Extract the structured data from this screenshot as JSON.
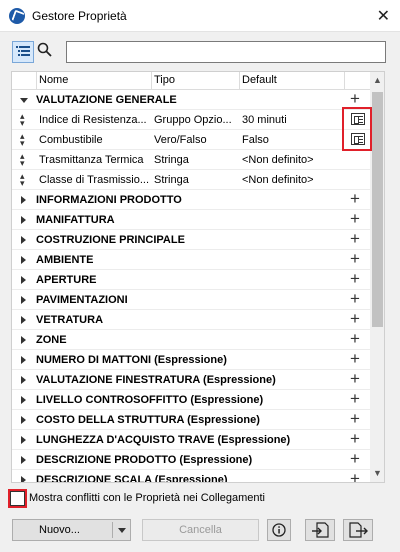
{
  "window": {
    "title": "Gestore Proprietà",
    "close_glyph": "✕",
    "app_icon": "archicad-logo-icon"
  },
  "toolbar": {
    "list_view_icon": "list-view-icon",
    "search_icon": "search-icon",
    "search_value": ""
  },
  "table": {
    "columns": [
      "Nome",
      "Tipo",
      "Default"
    ],
    "groups": [
      {
        "label": "VALUTAZIONE GENERALE",
        "expanded": true,
        "properties": [
          {
            "name": "Indice di Resistenza...",
            "type": "Gruppo Opzio...",
            "default": "30 minuti",
            "icon": "expression-doc-icon"
          },
          {
            "name": "Combustibile",
            "type": "Vero/Falso",
            "default": "Falso",
            "icon": "expression-doc-icon"
          },
          {
            "name": "Trasmittanza Termica",
            "type": "Stringa",
            "default": "<Non definito>",
            "icon": ""
          },
          {
            "name": "Classe di Trasmissio...",
            "type": "Stringa",
            "default": "<Non definito>",
            "icon": ""
          }
        ]
      },
      {
        "label": "INFORMAZIONI PRODOTTO",
        "expanded": false
      },
      {
        "label": "MANIFATTURA",
        "expanded": false
      },
      {
        "label": "COSTRUZIONE PRINCIPALE",
        "expanded": false
      },
      {
        "label": "AMBIENTE",
        "expanded": false
      },
      {
        "label": "APERTURE",
        "expanded": false
      },
      {
        "label": "PAVIMENTAZIONI",
        "expanded": false
      },
      {
        "label": "VETRATURA",
        "expanded": false
      },
      {
        "label": "ZONE",
        "expanded": false
      },
      {
        "label": "NUMERO DI MATTONI (Espressione)",
        "expanded": false
      },
      {
        "label": "VALUTAZIONE FINESTRATURA (Espressione)",
        "expanded": false
      },
      {
        "label": "LIVELLO CONTROSOFFITTO (Espressione)",
        "expanded": false
      },
      {
        "label": "COSTO DELLA STRUTTURA (Espressione)",
        "expanded": false
      },
      {
        "label": "LUNGHEZZA D'ACQUISTO TRAVE (Espressione)",
        "expanded": false
      },
      {
        "label": "DESCRIZIONE PRODOTTO (Espressione)",
        "expanded": false
      },
      {
        "label": "DESCRIZIONE SCALA (Espressione)",
        "expanded": false
      }
    ]
  },
  "options": {
    "show_conflicts_label": "Mostra conflitti con le Proprietà nei Collegamenti",
    "show_conflicts_checked": false
  },
  "buttons": {
    "new_label": "Nuovo...",
    "cancel_label": "Cancella",
    "info_icon": "info-icon",
    "import_icon": "import-icon",
    "export_icon": "export-icon"
  },
  "colors": {
    "highlight": "#e0202a",
    "selected_tool": "#d6e8fb"
  }
}
